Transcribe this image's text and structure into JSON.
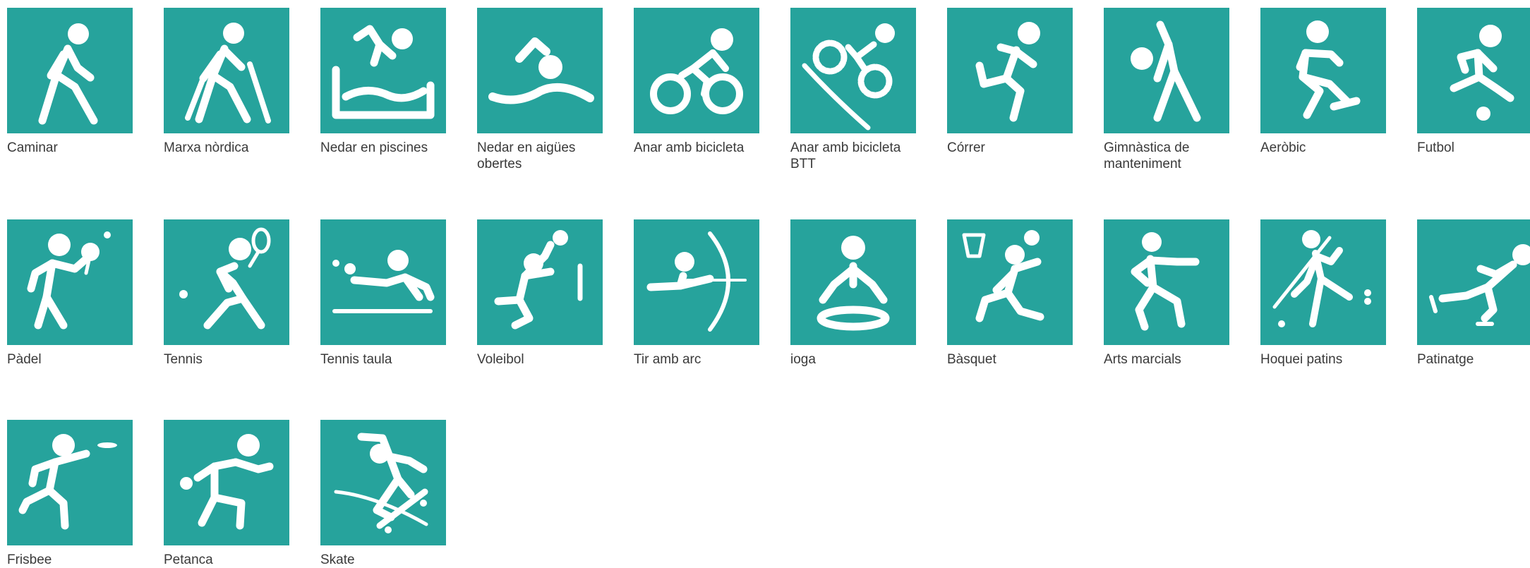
{
  "icon_color": "#26a39c",
  "glyph_color": "#ffffff",
  "rows": [
    [
      {
        "label": "Caminar",
        "icon": "walking-icon"
      },
      {
        "label": "Marxa nòrdica",
        "icon": "nordic-walking-icon"
      },
      {
        "label": "Nedar en piscines",
        "icon": "pool-swimming-icon"
      },
      {
        "label": "Nedar en aigües obertes",
        "icon": "open-water-swimming-icon"
      },
      {
        "label": "Anar amb bicicleta",
        "icon": "cycling-icon"
      },
      {
        "label": "Anar amb bicicleta BTT",
        "icon": "mountain-biking-icon"
      },
      {
        "label": "Córrer",
        "icon": "running-icon"
      },
      {
        "label": "Gimnàstica de manteniment",
        "icon": "maintenance-gymnastics-icon"
      },
      {
        "label": "Aeròbic",
        "icon": "aerobics-icon"
      },
      {
        "label": "Futbol",
        "icon": "football-icon"
      }
    ],
    [
      {
        "label": "Pàdel",
        "icon": "padel-icon"
      },
      {
        "label": "Tennis",
        "icon": "tennis-icon"
      },
      {
        "label": "Tennis taula",
        "icon": "table-tennis-icon"
      },
      {
        "label": "Voleibol",
        "icon": "volleyball-icon"
      },
      {
        "label": "Tir amb arc",
        "icon": "archery-icon"
      },
      {
        "label": "ioga",
        "icon": "yoga-icon"
      },
      {
        "label": "Bàsquet",
        "icon": "basketball-icon"
      },
      {
        "label": "Arts marcials",
        "icon": "martial-arts-icon"
      },
      {
        "label": "Hoquei patins",
        "icon": "roller-hockey-icon"
      },
      {
        "label": "Patinatge",
        "icon": "skating-icon"
      }
    ],
    [
      {
        "label": "Frisbee",
        "icon": "frisbee-icon"
      },
      {
        "label": "Petanca",
        "icon": "petanque-icon"
      },
      {
        "label": "Skate",
        "icon": "skateboard-icon"
      }
    ]
  ]
}
